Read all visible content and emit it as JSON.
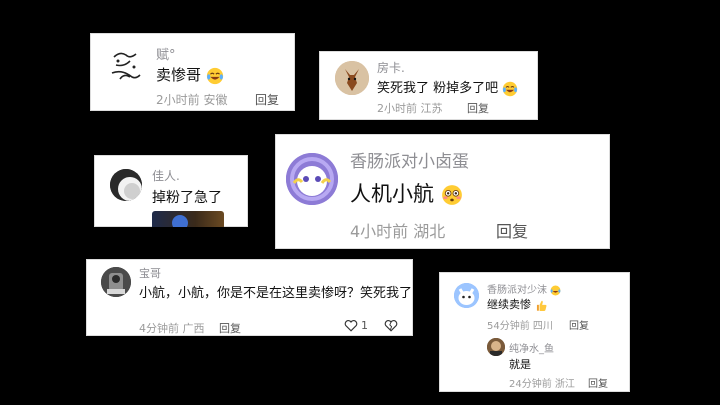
{
  "comments": [
    {
      "user": "赋°",
      "text": "卖惨哥",
      "emoji": "laugh-tears",
      "time": "2小时前",
      "location": "安徽",
      "reply": "回复"
    },
    {
      "user": "房卡.",
      "text": "笑死我了 粉掉多了吧",
      "emoji": "laugh-tears",
      "time": "2小时前",
      "location": "江苏",
      "reply": "回复"
    },
    {
      "user": "佳人.",
      "text": "掉粉了急了"
    },
    {
      "user": "香肠派对小卤蛋",
      "text": "人机小航",
      "emoji": "flushed",
      "time": "4小时前",
      "location": "湖北",
      "reply": "回复"
    },
    {
      "user": "宝哥",
      "text": "小航，小航，你是不是在这里卖惨呀？笑死我了",
      "time": "4分钟前",
      "location": "广西",
      "reply": "回复",
      "likes": "1"
    },
    {
      "user": "香肠派对少沫",
      "text": "继续卖惨",
      "emoji": "thumbs-up",
      "time": "54分钟前",
      "location": "四川",
      "reply": "回复"
    },
    {
      "user": "纯净水_鱼",
      "text": "就是",
      "time": "24分钟前",
      "location": "浙江",
      "reply": "回复"
    }
  ],
  "colors": {
    "background": "#000000",
    "card": "#ffffff",
    "username": "#8e8e93",
    "meta": "#9b9b9b"
  }
}
